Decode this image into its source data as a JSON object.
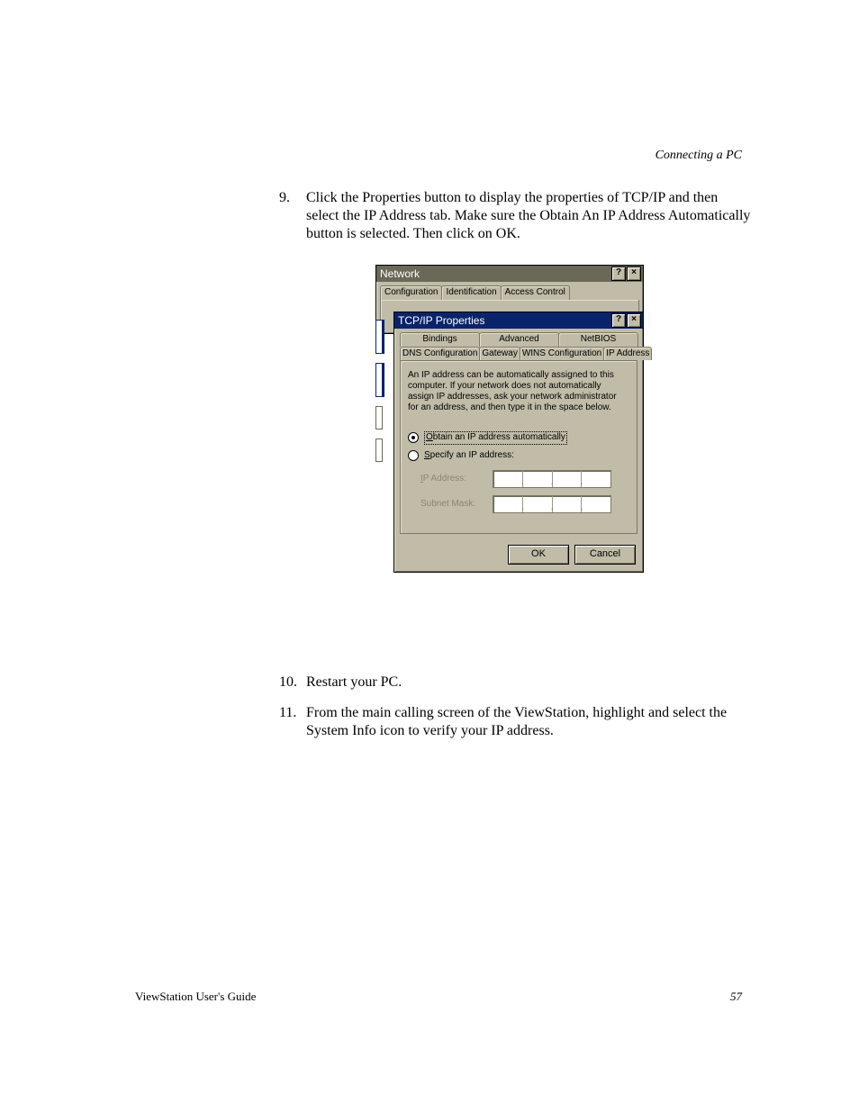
{
  "header_running": "Connecting a PC",
  "steps": {
    "s9_num": "9.",
    "s9_text": "Click the Properties button to display the properties of TCP/IP and then select the IP Address tab. Make sure the Obtain An IP Address Automatically button is selected. Then click on OK.",
    "s10_num": "10.",
    "s10_text": "Restart your PC.",
    "s11_num": "11.",
    "s11_text": "From the main calling screen of the ViewStation, highlight and select the System Info icon to verify your IP address."
  },
  "network_dialog": {
    "title": "Network",
    "help_glyph": "?",
    "close_glyph": "×",
    "tabs": {
      "configuration": "Configuration",
      "identification": "Identification",
      "access_control": "Access Control"
    }
  },
  "tcpip_dialog": {
    "title": "TCP/IP Properties",
    "help_glyph": "?",
    "close_glyph": "×",
    "tabs_row1": {
      "bindings": "Bindings",
      "advanced": "Advanced",
      "netbios": "NetBIOS"
    },
    "tabs_row2": {
      "dns": "DNS Configuration",
      "gateway": "Gateway",
      "wins": "WINS Configuration",
      "ip_address": "IP Address"
    },
    "description": "An IP address can be automatically assigned to this computer. If your network does not automatically assign IP addresses, ask your network administrator for an address, and then type it in the space below.",
    "radio_obtain_prefix": "O",
    "radio_obtain_rest": "btain an IP address automatically",
    "radio_specify_prefix": "S",
    "radio_specify_rest": "pecify an IP address:",
    "ip_label_prefix": "I",
    "ip_label_rest": "P Address:",
    "subnet_label": "Subnet Mask:",
    "ok": "OK",
    "cancel": "Cancel"
  },
  "footer": {
    "left": "ViewStation User's Guide",
    "right": "57"
  }
}
